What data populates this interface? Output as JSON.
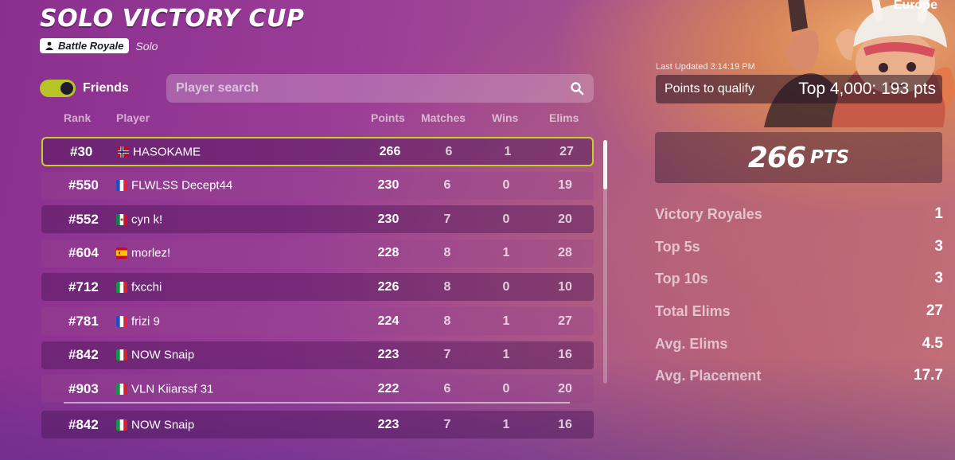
{
  "event": {
    "title": "SOLO VICTORY CUP",
    "mode": "Battle Royale",
    "submode": "Solo",
    "region": "Europe"
  },
  "filters": {
    "friends_label": "Friends",
    "friends_on": true,
    "search_placeholder": "Player search"
  },
  "columns": {
    "rank": "Rank",
    "player": "Player",
    "points": "Points",
    "matches": "Matches",
    "wins": "Wins",
    "elims": "Elims"
  },
  "leaderboard": [
    {
      "rank": "#30",
      "flag": "norway",
      "player": "HASOKAME",
      "points": "266",
      "matches": "6",
      "wins": "1",
      "elims": "27"
    },
    {
      "rank": "#550",
      "flag": "france",
      "player": "FLWLSS Decept44",
      "points": "230",
      "matches": "6",
      "wins": "0",
      "elims": "19"
    },
    {
      "rank": "#552",
      "flag": "mexico",
      "player": "cyn k!",
      "points": "230",
      "matches": "7",
      "wins": "0",
      "elims": "20"
    },
    {
      "rank": "#604",
      "flag": "spain",
      "player": "morlez!",
      "points": "228",
      "matches": "8",
      "wins": "1",
      "elims": "28"
    },
    {
      "rank": "#712",
      "flag": "italy",
      "player": "fxcchi",
      "points": "226",
      "matches": "8",
      "wins": "0",
      "elims": "10"
    },
    {
      "rank": "#781",
      "flag": "france",
      "player": "frizi 9",
      "points": "224",
      "matches": "8",
      "wins": "1",
      "elims": "27"
    },
    {
      "rank": "#842",
      "flag": "italy",
      "player": "NOW Snaip",
      "points": "223",
      "matches": "7",
      "wins": "1",
      "elims": "16"
    },
    {
      "rank": "#903",
      "flag": "italy",
      "player": "VLN Kiiarssf 31",
      "points": "222",
      "matches": "6",
      "wins": "0",
      "elims": "20"
    }
  ],
  "pinned_row": {
    "rank": "#842",
    "flag": "italy",
    "player": "NOW Snaip",
    "points": "223",
    "matches": "7",
    "wins": "1",
    "elims": "16"
  },
  "summary": {
    "last_updated": "Last Updated 3:14:19 PM",
    "qualify_label": "Points to qualify",
    "qualify_value": "Top 4,000: 193 pts",
    "points": "266",
    "points_unit": "PTS",
    "stats": [
      {
        "label": "Victory Royales",
        "value": "1"
      },
      {
        "label": "Top 5s",
        "value": "3"
      },
      {
        "label": "Top 10s",
        "value": "3"
      },
      {
        "label": "Total Elims",
        "value": "27"
      },
      {
        "label": "Avg. Elims",
        "value": "4.5"
      },
      {
        "label": "Avg. Placement",
        "value": "17.7"
      }
    ]
  },
  "colors": {
    "accent": "#c4d028",
    "toggle_on": "#b6c425"
  },
  "scroll_position": 0
}
